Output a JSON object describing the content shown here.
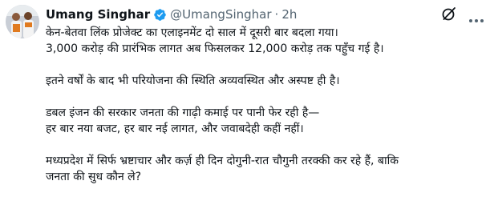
{
  "tweet": {
    "author_name": "Umang Singhar",
    "handle": "@UmangSinghar",
    "separator": "·",
    "time": "2h",
    "lines": [
      "केन-बेतवा लिंक प्रोजेक्ट का एलाइनमेंट दो साल में दूसरी बार बदला गया।",
      "3,000 करोड़ की प्रारंभिक लागत अब फिसलकर 12,000 करोड़ तक पहुँच गई है।",
      "इतने वर्षों के बाद भी परियोजना की स्थिति अव्यवस्थित और अस्पष्ट ही है।",
      "डबल इंजन की सरकार जनता की गाढ़ी कमाई पर पानी फेर रही है—",
      "हर बार नया बजट, हर बार नई लागत, और जवाबदेही कहीं नहीं।",
      "मध्यप्रदेश में सिर्फ भ्रष्टाचार और कर्ज़ ही दिन दोगुनी-रात चौगुनी तरक्की कर रहे हैं, बाकि",
      "जनता की सुध कौन ले?"
    ]
  },
  "colors": {
    "verified": "#1d9bf0",
    "secondary_text": "#536471"
  },
  "icons": {
    "avatar": "profile-photo",
    "verified": "verified-badge-icon",
    "grok": "grok-icon",
    "more": "more-options-icon"
  }
}
